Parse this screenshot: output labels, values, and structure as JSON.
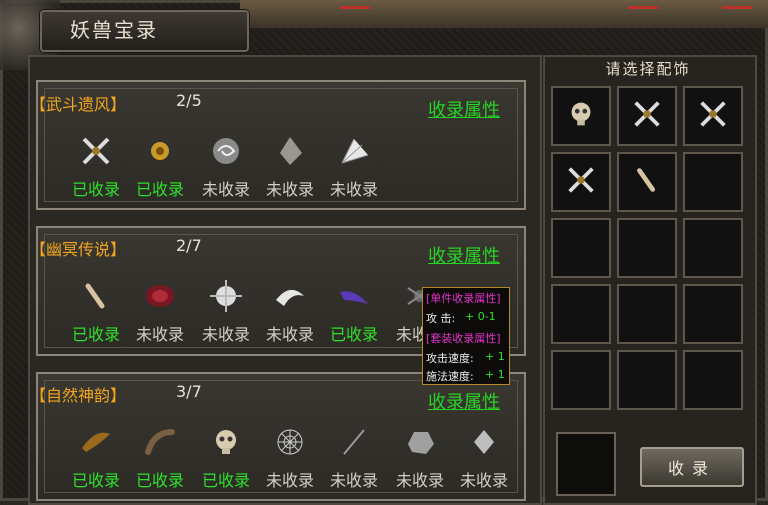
{
  "window": {
    "title": "妖兽宝录"
  },
  "sections": [
    {
      "name": "【武斗遗风】",
      "count": "2/5",
      "attr_link": "收录属性",
      "items": [
        {
          "icon": "crossed-blades-icon",
          "status": "已收录",
          "collected": true
        },
        {
          "icon": "golden-flower-icon",
          "status": "已收录",
          "collected": true
        },
        {
          "icon": "swirl-orb-icon",
          "status": "未收录",
          "collected": false
        },
        {
          "icon": "stone-shard-icon",
          "status": "未收录",
          "collected": false
        },
        {
          "icon": "white-fan-icon",
          "status": "未收录",
          "collected": false
        }
      ]
    },
    {
      "name": "【幽冥传说】",
      "count": "2/7",
      "attr_link": "收录属性",
      "items": [
        {
          "icon": "bone-icon",
          "status": "已收录",
          "collected": true
        },
        {
          "icon": "red-scale-icon",
          "status": "未收录",
          "collected": false
        },
        {
          "icon": "spiked-orb-icon",
          "status": "未收录",
          "collected": false
        },
        {
          "icon": "white-claw-icon",
          "status": "未收录",
          "collected": false
        },
        {
          "icon": "purple-claw-icon",
          "status": "已收录",
          "collected": true
        },
        {
          "icon": "spider-icon",
          "status": "未收录",
          "collected": false
        }
      ]
    },
    {
      "name": "【自然神韵】",
      "count": "3/7",
      "attr_link": "收录属性",
      "items": [
        {
          "icon": "feather-icon",
          "status": "已收录",
          "collected": true
        },
        {
          "icon": "horn-icon",
          "status": "已收录",
          "collected": true
        },
        {
          "icon": "skull-icon",
          "status": "已收录",
          "collected": true
        },
        {
          "icon": "spider-web-icon",
          "status": "未收录",
          "collected": false
        },
        {
          "icon": "needle-icon",
          "status": "未收录",
          "collected": false
        },
        {
          "icon": "rock-icon",
          "status": "未收录",
          "collected": false
        },
        {
          "icon": "crystal-icon",
          "status": "未收录",
          "collected": false
        }
      ]
    }
  ],
  "tooltip": {
    "single_header": "[单件收录属性]",
    "attack_label": "攻 击:",
    "attack_value": "+ 0-1",
    "set_header": "[套装收录属性]",
    "atk_speed_label": "攻击速度:",
    "atk_speed_value": "+ 1",
    "cast_speed_label": "施法速度:",
    "cast_speed_value": "+ 1"
  },
  "accessory_panel": {
    "title": "请选择配饰",
    "slots": [
      "skull-icon",
      "crossed-blades-icon",
      "crossed-blades-icon",
      "crossed-blades-icon",
      "bone-icon",
      "",
      "",
      "",
      "",
      "",
      "",
      "",
      "",
      "",
      ""
    ],
    "collect_button": "收录"
  },
  "colors": {
    "collected": "#2fe02a",
    "uncollected": "#d4cfc6",
    "section_name": "#f0a71e",
    "link": "#27d424"
  }
}
